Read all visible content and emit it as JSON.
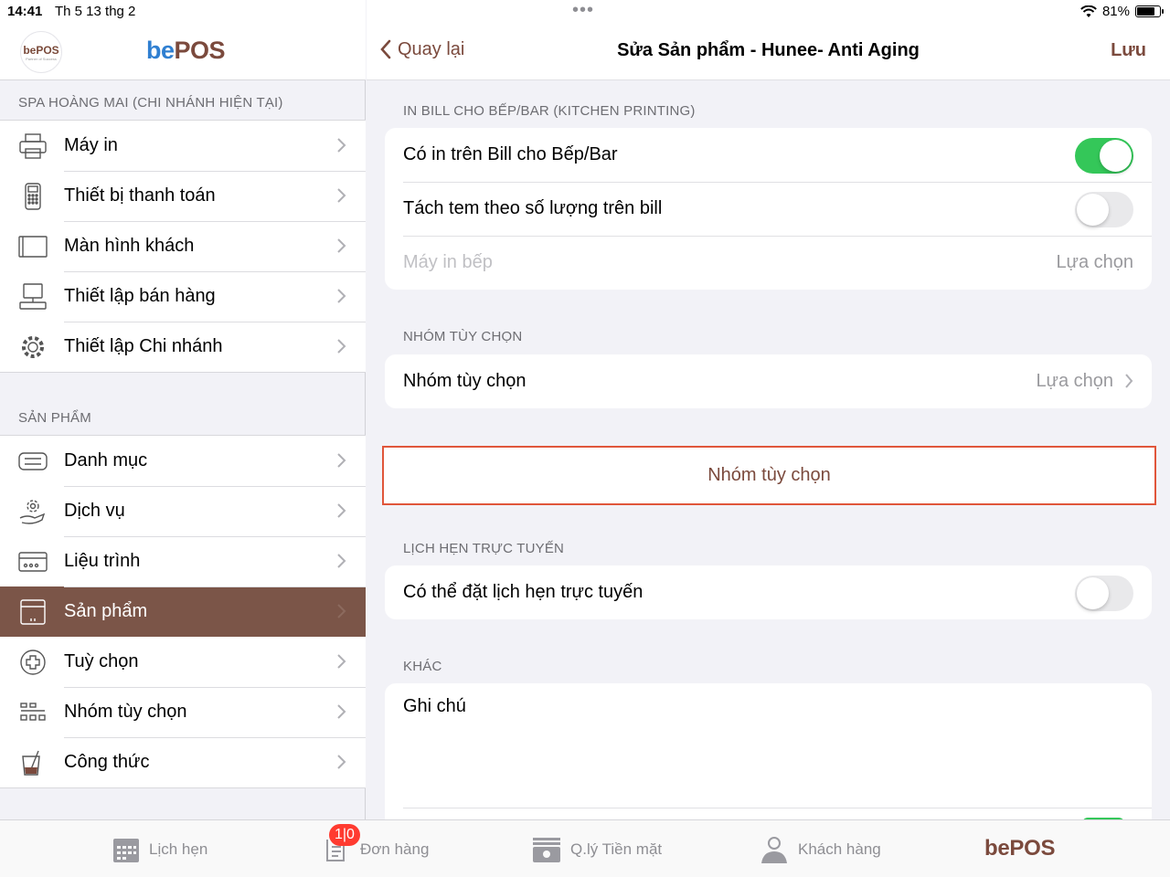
{
  "status": {
    "time": "14:41",
    "date": "Th 5 13 thg 2",
    "battery": "81%",
    "battery_level": 0.81
  },
  "sidebar": {
    "logo_text": "bePOS",
    "logo_sub": "Partner of Success",
    "brand_prefix": "be",
    "brand_suffix": "POS",
    "section1": "SPA HOÀNG MAI  (CHI NHÁNH HIỆN TẠI)",
    "settings": [
      {
        "label": "Máy in",
        "icon": "printer-icon"
      },
      {
        "label": "Thiết bị thanh toán",
        "icon": "payment-terminal-icon"
      },
      {
        "label": "Màn hình khách",
        "icon": "customer-display-icon"
      },
      {
        "label": "Thiết lập bán hàng",
        "icon": "pos-terminal-icon"
      },
      {
        "label": "Thiết lập Chi nhánh",
        "icon": "gear-icon"
      }
    ],
    "section2": "SẢN PHẨM",
    "products": [
      {
        "label": "Danh mục",
        "icon": "category-icon"
      },
      {
        "label": "Dịch vụ",
        "icon": "service-icon"
      },
      {
        "label": "Liệu trình",
        "icon": "treatment-card-icon"
      },
      {
        "label": "Sản phẩm",
        "icon": "product-box-icon",
        "active": true
      },
      {
        "label": "Tuỳ chọn",
        "icon": "plus-circle-icon"
      },
      {
        "label": "Nhóm tùy chọn",
        "icon": "option-group-icon"
      },
      {
        "label": "Công thức",
        "icon": "recipe-icon"
      }
    ]
  },
  "nav": {
    "back_label": "Quay lại",
    "title": "Sửa Sản phẩm - Hunee- Anti Aging",
    "save_label": "Lưu"
  },
  "kitchen": {
    "header": "IN BILL CHO BẾP/BAR (KITCHEN PRINTING)",
    "print_on_bill": {
      "label": "Có in trên Bill cho Bếp/Bar",
      "on": true
    },
    "split_labels": {
      "label": "Tách tem theo số lượng trên bill",
      "on": false
    },
    "kitchen_printer": {
      "label": "Máy in bếp",
      "value": "Lựa chọn"
    }
  },
  "options": {
    "header": "NHÓM TÙY CHỌN",
    "row": {
      "label": "Nhóm tùy chọn",
      "value": "Lựa chọn"
    },
    "button_label": "Nhóm tùy chọn"
  },
  "booking": {
    "header": "LỊCH HẸN TRỰC TUYẾN",
    "row": {
      "label": "Có thể đặt lịch hẹn trực tuyến",
      "on": false
    }
  },
  "other": {
    "header": "KHÁC",
    "note_label": "Ghi chú"
  },
  "tabbar": {
    "appointments": "Lịch hẹn",
    "orders": "Đơn hàng",
    "orders_badge": "1|0",
    "cash": "Q.lý Tiền mặt",
    "customers": "Khách hàng",
    "brand": "bePOS"
  },
  "colors": {
    "accent": "#7b4a3d",
    "brand_blue": "#2f7fd1",
    "toggle_on": "#34c759",
    "highlight": "#e0563b",
    "active_row": "#7b5548"
  }
}
